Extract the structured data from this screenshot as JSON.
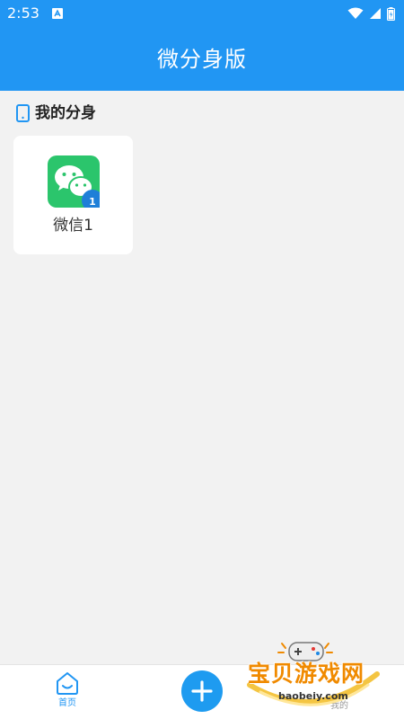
{
  "status_bar": {
    "time": "2:53"
  },
  "app_bar": {
    "title": "微分身版"
  },
  "section": {
    "title": "我的分身"
  },
  "clones": [
    {
      "label": "微信1",
      "badge": "1",
      "icon": "wechat-icon"
    }
  ],
  "bottom_nav": {
    "home_label": "首页",
    "mine_label": "我的"
  },
  "watermark": {
    "text": "宝贝游戏网",
    "url": "baobeiy.com"
  },
  "colors": {
    "primary": "#2196f3",
    "wechat_green": "#2bc56c",
    "background": "#f2f2f2"
  }
}
